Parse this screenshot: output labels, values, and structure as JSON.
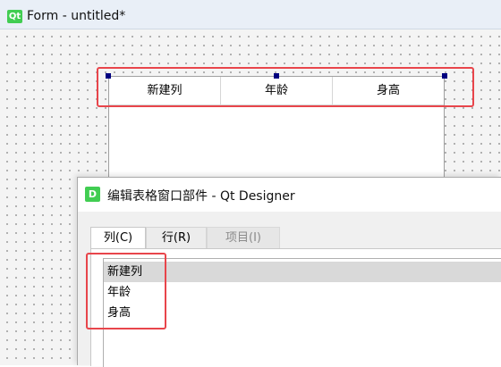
{
  "form": {
    "logo_text": "Qt",
    "title": "Form - untitled*",
    "table_headers": [
      "新建列",
      "年龄",
      "身高"
    ]
  },
  "dialog": {
    "logo_text": "D",
    "title": "编辑表格窗口部件 - Qt Designer",
    "tabs": [
      {
        "label": "列(C)",
        "state": "active"
      },
      {
        "label": "行(R)",
        "state": "inactive"
      },
      {
        "label": "项目(I)",
        "state": "disabled"
      }
    ],
    "columns": [
      "新建列",
      "年龄",
      "身高"
    ]
  },
  "colors": {
    "highlight_red": "#e8454b",
    "selection_handle": "#000080",
    "qt_green": "#41cd52"
  }
}
